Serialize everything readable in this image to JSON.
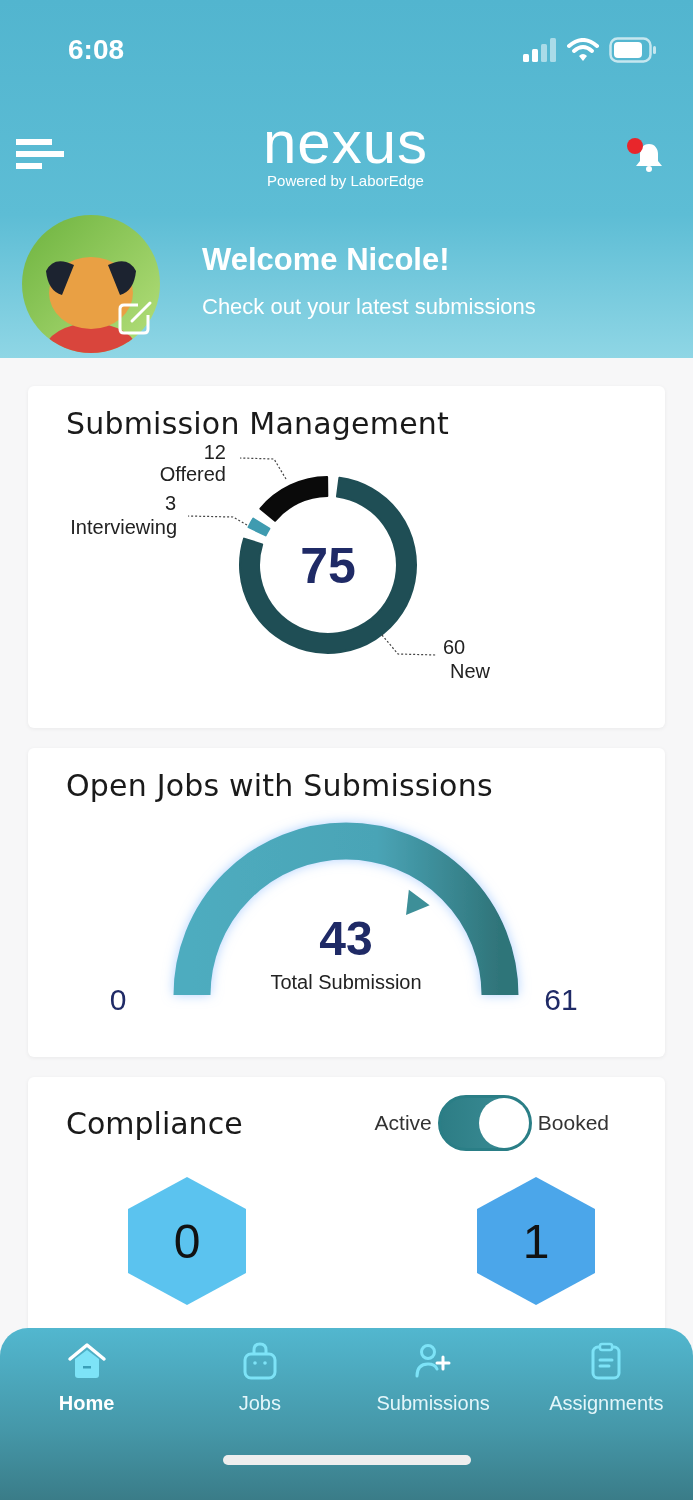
{
  "status_bar": {
    "time": "6:08"
  },
  "header": {
    "logo": "nexus",
    "logo_tagline": "Powered by LaborEdge",
    "notification_unread": true
  },
  "welcome": {
    "title": "Welcome Nicole!",
    "subtitle": "Check out your latest submissions"
  },
  "submission_management": {
    "title": "Submission Management",
    "total": "75",
    "chart_data": {
      "type": "donut",
      "categories": [
        "New",
        "Interviewing",
        "Offered"
      ],
      "values": [
        60,
        3,
        12
      ],
      "value_labels": [
        "60",
        "3",
        "12"
      ],
      "colors": [
        "#1f4e55",
        "#3f9bb0",
        "#0a0a0a"
      ]
    }
  },
  "open_jobs": {
    "title": "Open Jobs with Submissions",
    "value": "43",
    "label": "Total Submission",
    "min": "0",
    "max": "61"
  },
  "compliance": {
    "title": "Compliance",
    "toggle": {
      "off_label": "Active",
      "on_label": "Booked",
      "on": true
    },
    "stats": [
      {
        "value": "0",
        "color": "#5bc3ef"
      },
      {
        "value": "1",
        "color": "#4ba6ea"
      }
    ]
  },
  "bottom_nav": [
    {
      "kind": "home",
      "label": "Home",
      "selected": true
    },
    {
      "kind": "jobs",
      "label": "Jobs",
      "selected": false
    },
    {
      "kind": "submissions",
      "label": "Submissions",
      "selected": false
    },
    {
      "kind": "assignments",
      "label": "Assignments",
      "selected": false
    }
  ]
}
